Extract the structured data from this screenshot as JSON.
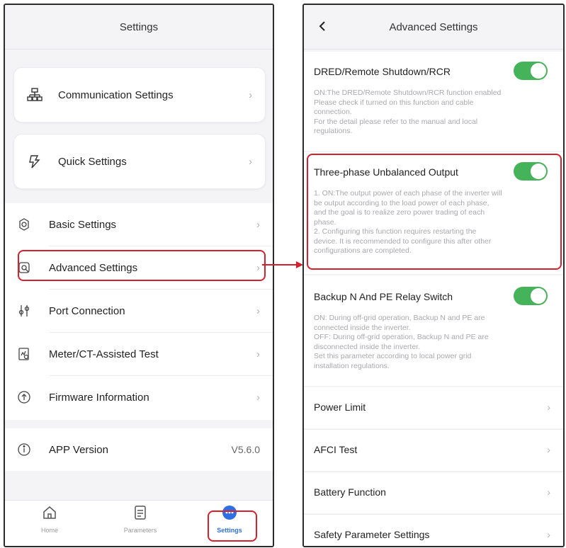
{
  "left": {
    "title": "Settings",
    "cards": [
      {
        "label": "Communication Settings",
        "icon": "network-icon"
      },
      {
        "label": "Quick Settings",
        "icon": "lightning-icon"
      }
    ],
    "items": [
      {
        "label": "Basic Settings",
        "icon": "gear-icon"
      },
      {
        "label": "Advanced Settings",
        "icon": "advanced-gear-icon"
      },
      {
        "label": "Port Connection",
        "icon": "port-icon"
      },
      {
        "label": "Meter/CT-Assisted Test",
        "icon": "meter-test-icon"
      },
      {
        "label": "Firmware Information",
        "icon": "firmware-icon"
      }
    ],
    "app_version": {
      "label": "APP Version",
      "value": "V5.6.0",
      "icon": "info-icon"
    },
    "tabs": [
      {
        "label": "Home",
        "icon": "home-icon"
      },
      {
        "label": "Parameters",
        "icon": "parameters-icon"
      },
      {
        "label": "Settings",
        "icon": "settings-dots-icon"
      }
    ]
  },
  "right": {
    "title": "Advanced Settings",
    "toggles": [
      {
        "title": "DRED/Remote Shutdown/RCR",
        "on": true,
        "desc": [
          "ON:The DRED/Remote Shutdown/RCR function enabled",
          "Please check if turned on this function and cable",
          "connection.",
          "For the detail please refer to the manual and local",
          "regulations."
        ]
      },
      {
        "title": "Three-phase Unbalanced Output",
        "on": true,
        "desc": [
          "1. ON:The output power of each phase of the inverter will",
          "be output according to the load power of each phase,",
          "and the goal is to realize zero power trading of each",
          "phase.",
          "2. Configuring this function requires restarting the",
          "device. It is recommended to configure this after other",
          "configurations are completed."
        ]
      },
      {
        "title": "Backup N And PE Relay Switch",
        "on": true,
        "desc": [
          "ON: During off-grid operation, Backup N and PE are",
          "connected inside the inverter.",
          "OFF: During off-grid operation, Backup N and PE are",
          "disconnected inside the inverter.",
          "Set this parameter according to local power grid",
          "installation regulations."
        ]
      }
    ],
    "rows": [
      {
        "label": "Power Limit"
      },
      {
        "label": "AFCI Test"
      },
      {
        "label": "Battery Function"
      },
      {
        "label": "Safety Parameter Settings"
      }
    ]
  },
  "colors": {
    "accent_red": "#d8202c",
    "toggle_green": "#44b35a",
    "tab_active": "#2f6fe4"
  }
}
